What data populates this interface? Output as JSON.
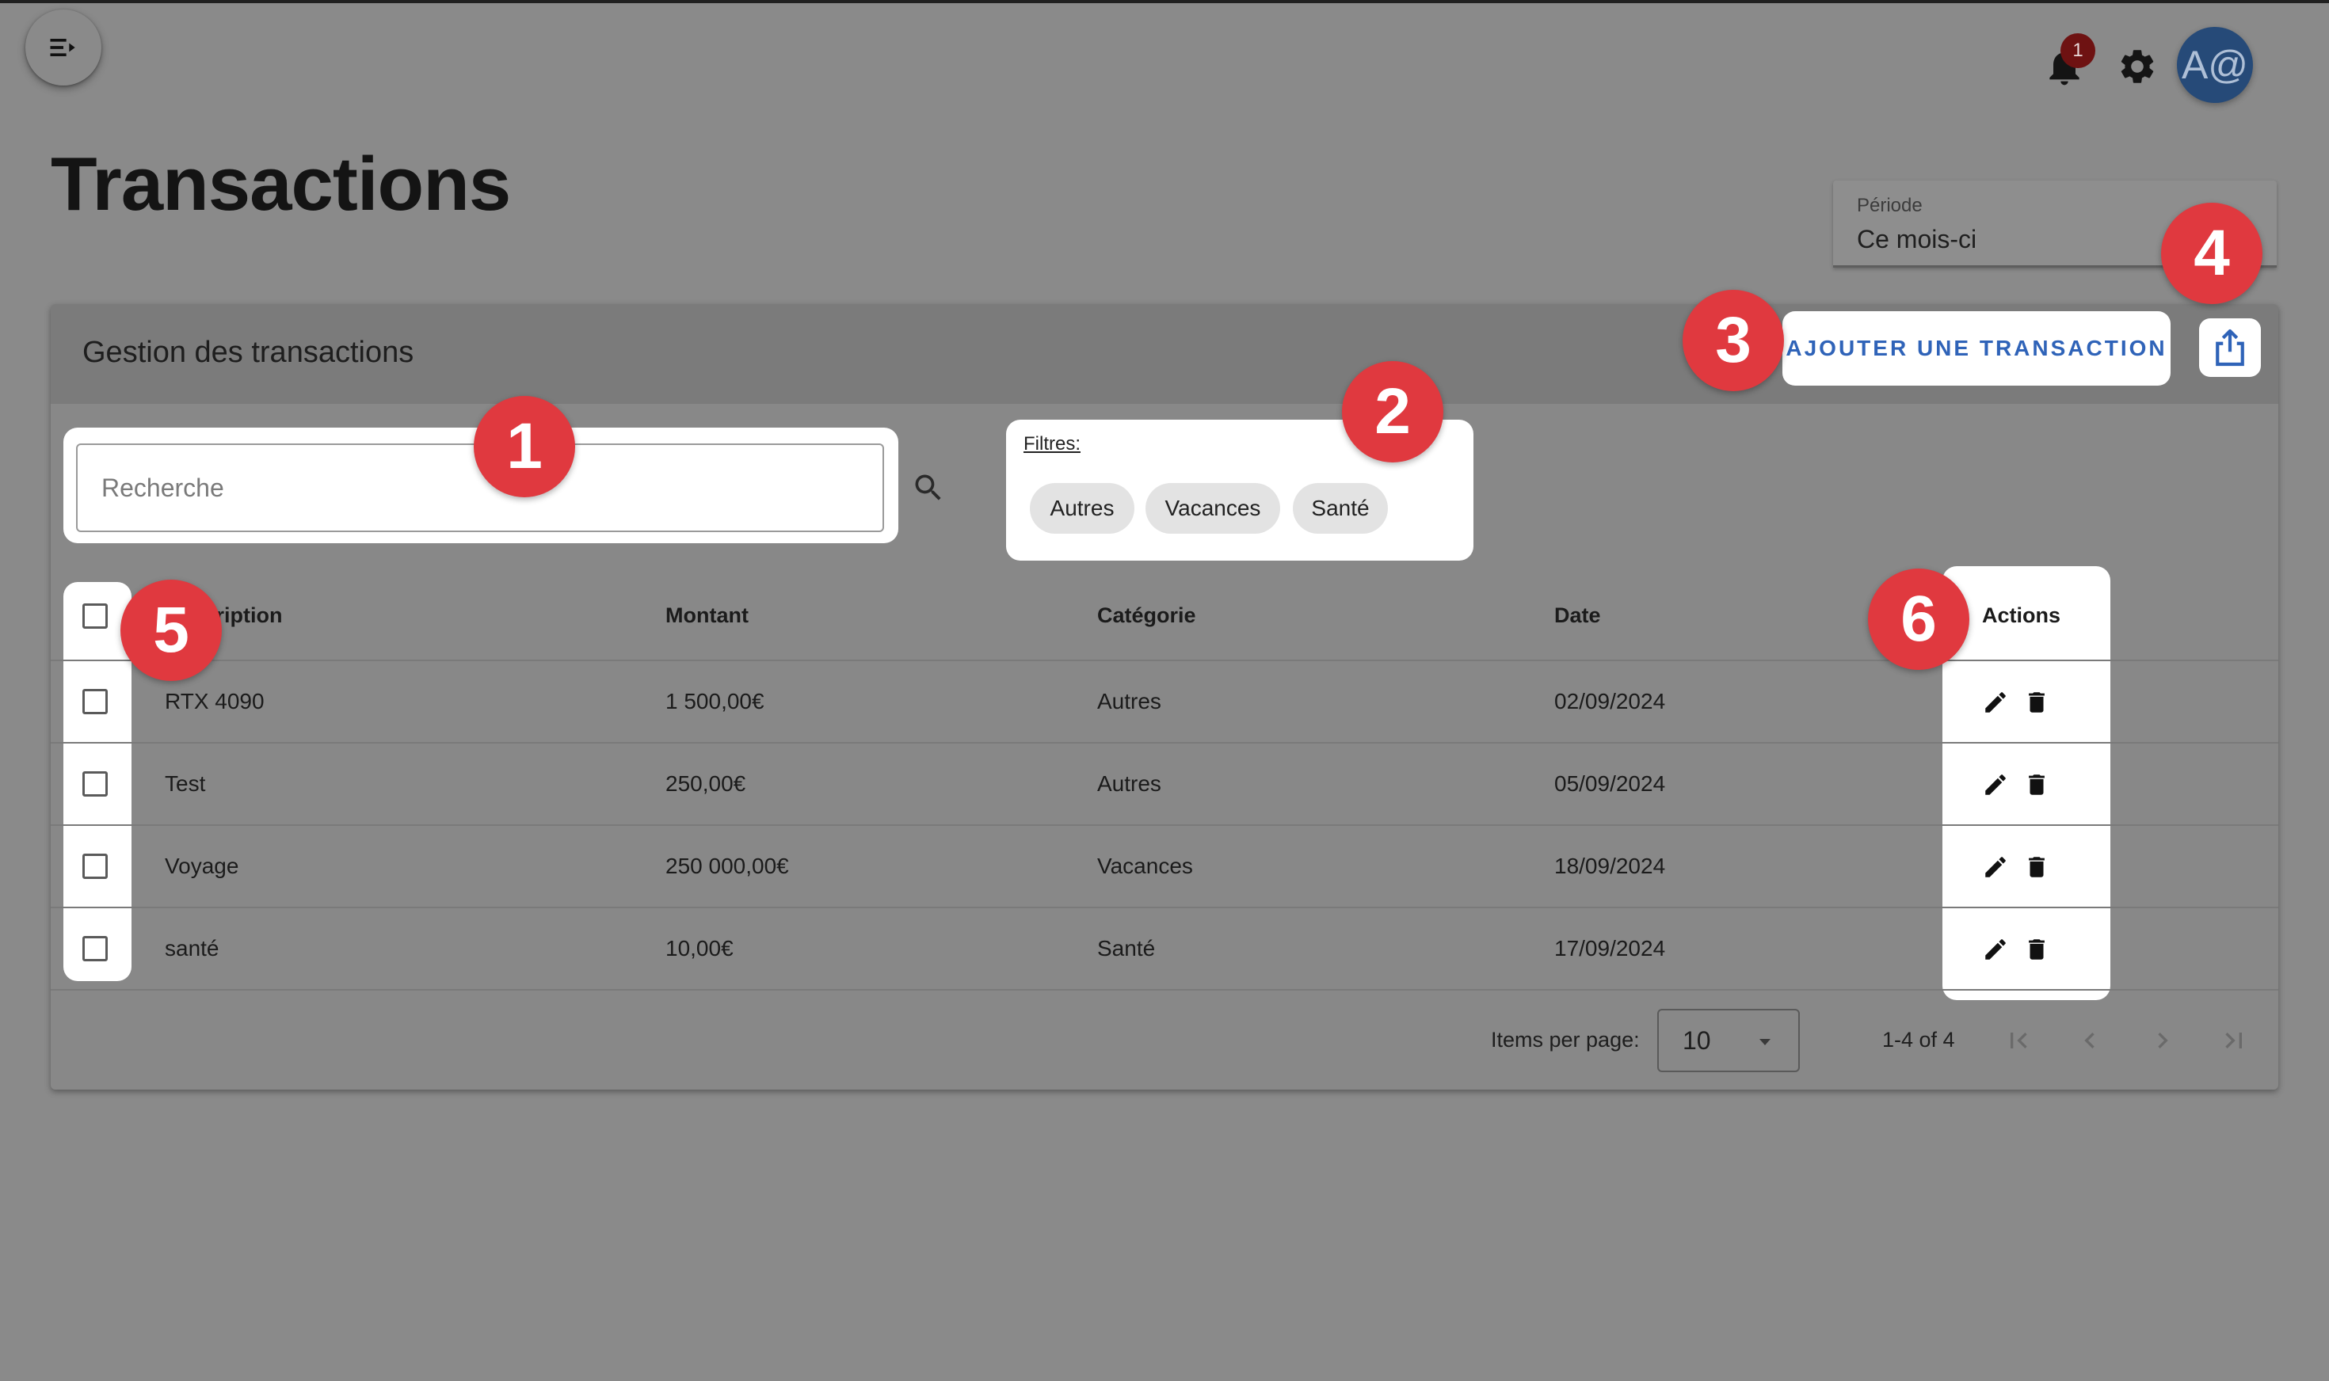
{
  "page": {
    "title": "Transactions"
  },
  "notifications": {
    "count": "1"
  },
  "user": {
    "avatar_initials": "A@"
  },
  "periode": {
    "label": "Période",
    "value": "Ce mois-ci"
  },
  "card": {
    "title": "Gestion des transactions",
    "add_button": "AJOUTER UNE TRANSACTION"
  },
  "search": {
    "placeholder": "Recherche"
  },
  "filters": {
    "label": "Filtres:",
    "chips": [
      "Autres",
      "Vacances",
      "Santé"
    ]
  },
  "table": {
    "headers": {
      "description": "Description",
      "montant": "Montant",
      "categorie": "Catégorie",
      "date": "Date",
      "actions": "Actions"
    },
    "rows": [
      {
        "description": "RTX 4090",
        "montant": "1 500,00€",
        "categorie": "Autres",
        "date": "02/09/2024"
      },
      {
        "description": "Test",
        "montant": "250,00€",
        "categorie": "Autres",
        "date": "05/09/2024"
      },
      {
        "description": "Voyage",
        "montant": "250 000,00€",
        "categorie": "Vacances",
        "date": "18/09/2024"
      },
      {
        "description": "santé",
        "montant": "10,00€",
        "categorie": "Santé",
        "date": "17/09/2024"
      }
    ]
  },
  "pagination": {
    "items_per_page_label": "Items per page:",
    "items_per_page_value": "10",
    "range": "1-4 of 4"
  },
  "markers": [
    "1",
    "2",
    "3",
    "4",
    "5",
    "6"
  ],
  "icons": [
    "menu-open-icon",
    "bell-icon",
    "gear-icon",
    "search-icon",
    "share-icon",
    "edit-icon",
    "delete-icon",
    "first-page-icon",
    "prev-page-icon",
    "next-page-icon",
    "last-page-icon"
  ],
  "colors": {
    "background": "#8a8a8a",
    "accent": "#2f63b8",
    "marker": "#e0393f",
    "avatar": "#264a78",
    "badge": "#6e1212"
  }
}
